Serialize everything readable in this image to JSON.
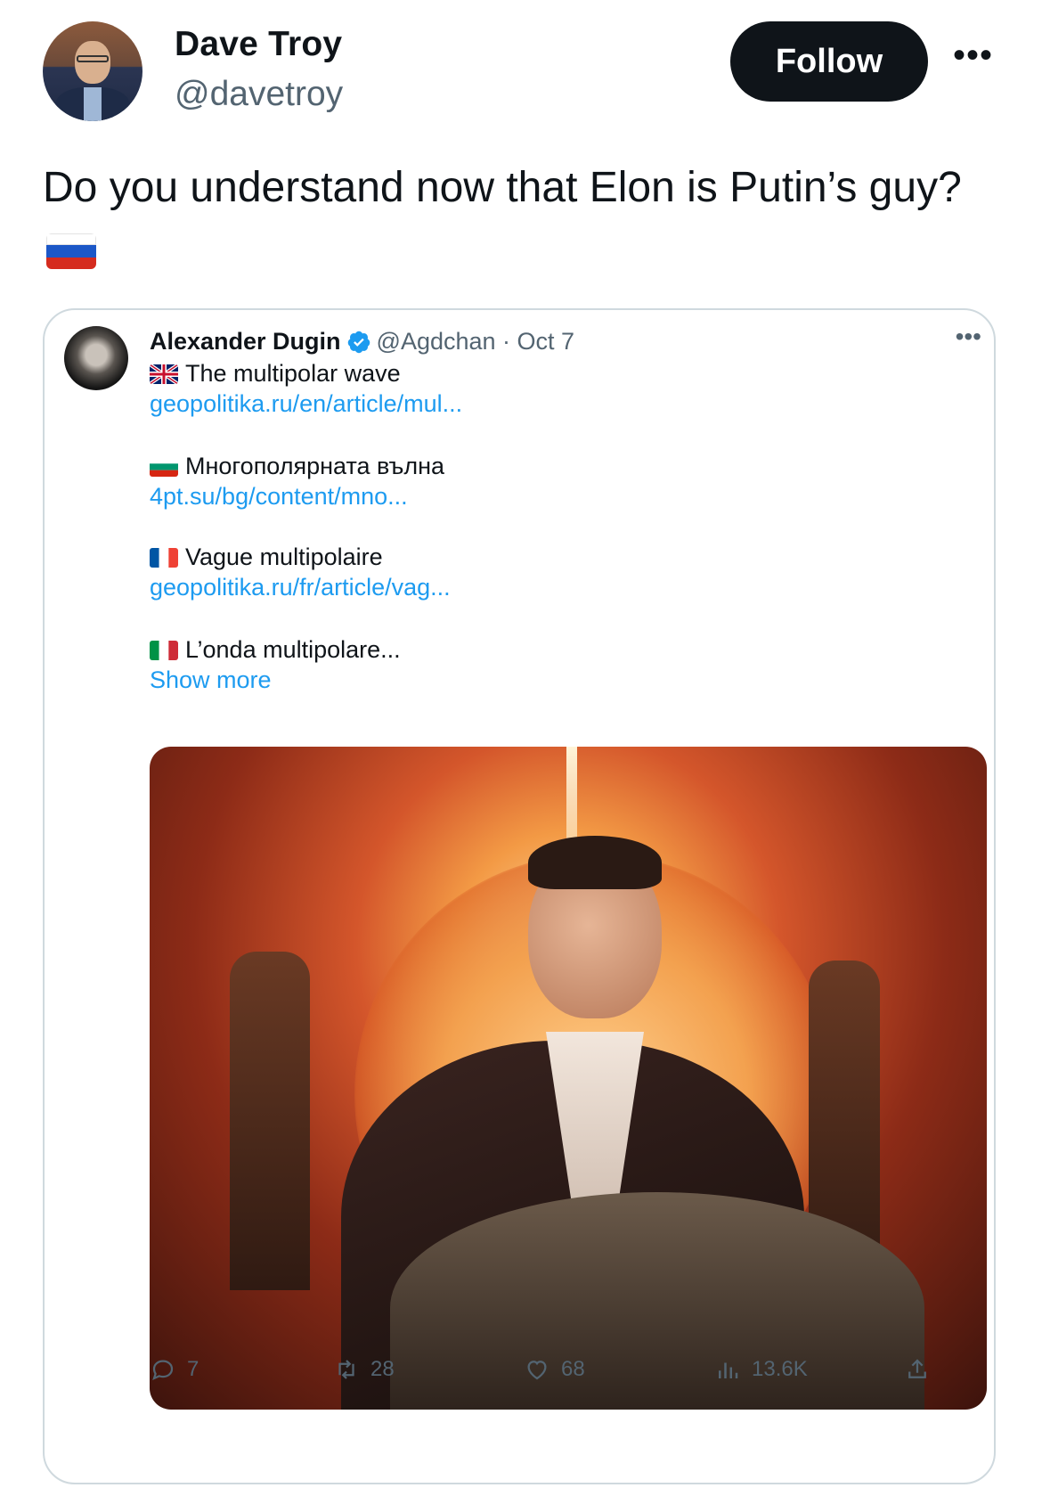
{
  "author": {
    "name": "Dave Troy",
    "handle": "@davetroy"
  },
  "follow_label": "Follow",
  "more_glyph": "•••",
  "tweet": {
    "text": "Do you understand now that Elon is Putin’s guy?",
    "flag_colors": [
      "#ffffff",
      "#1c57c7",
      "#d52b1e"
    ]
  },
  "quote": {
    "name": "Alexander Dugin",
    "handle_date": "@Agdchan · Oct 7",
    "more_glyph": "•••",
    "lines": [
      {
        "flag": "gb-flag-icon",
        "text": "The multipolar wave",
        "link": "geopolitika.ru/en/article/mul..."
      },
      {
        "flag": "bg-flag-icon",
        "text": "Многополярната вълна",
        "link": "4pt.su/bg/content/mno..."
      },
      {
        "flag": "fr-flag-icon",
        "text": "Vague multipolaire",
        "link": "geopolitika.ru/fr/article/vag..."
      },
      {
        "flag": "it-flag-icon",
        "text": "L’onda multipolare...",
        "link": "Show more"
      }
    ],
    "media": "ai-illustration-man-in-suit-before-sun",
    "actions": {
      "replies": "7",
      "retweets": "28",
      "likes": "68",
      "views": "13.6K"
    }
  },
  "colors": {
    "text": "#0f1419",
    "secondary": "#536471",
    "link": "#1d9bf0",
    "border": "#cfd9de"
  }
}
